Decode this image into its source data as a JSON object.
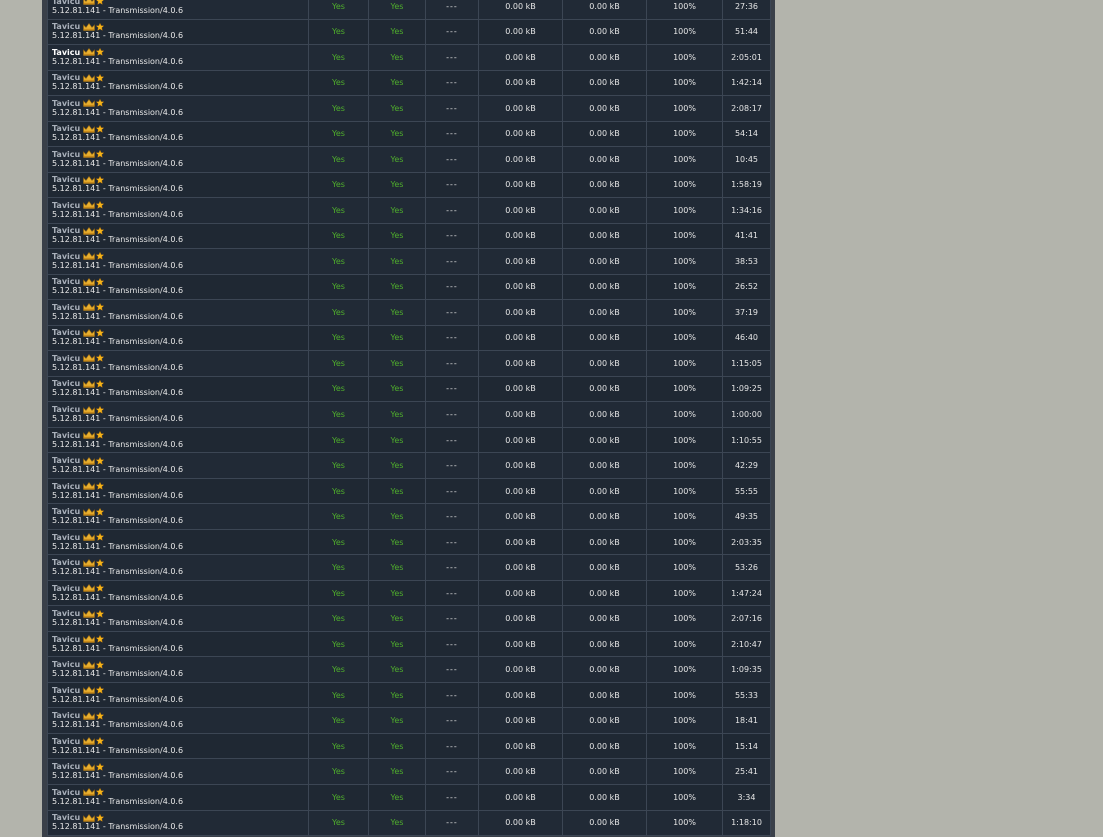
{
  "peers": {
    "rows": [
      {
        "user": "Tavicu",
        "client": "5.12.81.141 - Transmission/4.0.6",
        "connectable": "Yes",
        "seeding": "Yes",
        "speed": "---",
        "uploaded": "0.00 kB",
        "downloaded": "0.00 kB",
        "progress": "100%",
        "time": "27:36"
      },
      {
        "user": "Tavicu",
        "client": "5.12.81.141 - Transmission/4.0.6",
        "connectable": "Yes",
        "seeding": "Yes",
        "speed": "---",
        "uploaded": "0.00 kB",
        "downloaded": "0.00 kB",
        "progress": "100%",
        "time": "51:44"
      },
      {
        "user": "Tavicu",
        "client": "5.12.81.141 - Transmission/4.0.6",
        "connectable": "Yes",
        "seeding": "Yes",
        "speed": "---",
        "uploaded": "0.00 kB",
        "downloaded": "0.00 kB",
        "progress": "100%",
        "time": "2:05:01"
      },
      {
        "user": "Tavicu",
        "client": "5.12.81.141 - Transmission/4.0.6",
        "connectable": "Yes",
        "seeding": "Yes",
        "speed": "---",
        "uploaded": "0.00 kB",
        "downloaded": "0.00 kB",
        "progress": "100%",
        "time": "1:42:14"
      },
      {
        "user": "Tavicu",
        "client": "5.12.81.141 - Transmission/4.0.6",
        "connectable": "Yes",
        "seeding": "Yes",
        "speed": "---",
        "uploaded": "0.00 kB",
        "downloaded": "0.00 kB",
        "progress": "100%",
        "time": "2:08:17"
      },
      {
        "user": "Tavicu",
        "client": "5.12.81.141 - Transmission/4.0.6",
        "connectable": "Yes",
        "seeding": "Yes",
        "speed": "---",
        "uploaded": "0.00 kB",
        "downloaded": "0.00 kB",
        "progress": "100%",
        "time": "54:14"
      },
      {
        "user": "Tavicu",
        "client": "5.12.81.141 - Transmission/4.0.6",
        "connectable": "Yes",
        "seeding": "Yes",
        "speed": "---",
        "uploaded": "0.00 kB",
        "downloaded": "0.00 kB",
        "progress": "100%",
        "time": "10:45"
      },
      {
        "user": "Tavicu",
        "client": "5.12.81.141 - Transmission/4.0.6",
        "connectable": "Yes",
        "seeding": "Yes",
        "speed": "---",
        "uploaded": "0.00 kB",
        "downloaded": "0.00 kB",
        "progress": "100%",
        "time": "1:58:19"
      },
      {
        "user": "Tavicu",
        "client": "5.12.81.141 - Transmission/4.0.6",
        "connectable": "Yes",
        "seeding": "Yes",
        "speed": "---",
        "uploaded": "0.00 kB",
        "downloaded": "0.00 kB",
        "progress": "100%",
        "time": "1:34:16"
      },
      {
        "user": "Tavicu",
        "client": "5.12.81.141 - Transmission/4.0.6",
        "connectable": "Yes",
        "seeding": "Yes",
        "speed": "---",
        "uploaded": "0.00 kB",
        "downloaded": "0.00 kB",
        "progress": "100%",
        "time": "41:41"
      },
      {
        "user": "Tavicu",
        "client": "5.12.81.141 - Transmission/4.0.6",
        "connectable": "Yes",
        "seeding": "Yes",
        "speed": "---",
        "uploaded": "0.00 kB",
        "downloaded": "0.00 kB",
        "progress": "100%",
        "time": "38:53"
      },
      {
        "user": "Tavicu",
        "client": "5.12.81.141 - Transmission/4.0.6",
        "connectable": "Yes",
        "seeding": "Yes",
        "speed": "---",
        "uploaded": "0.00 kB",
        "downloaded": "0.00 kB",
        "progress": "100%",
        "time": "26:52"
      },
      {
        "user": "Tavicu",
        "client": "5.12.81.141 - Transmission/4.0.6",
        "connectable": "Yes",
        "seeding": "Yes",
        "speed": "---",
        "uploaded": "0.00 kB",
        "downloaded": "0.00 kB",
        "progress": "100%",
        "time": "37:19"
      },
      {
        "user": "Tavicu",
        "client": "5.12.81.141 - Transmission/4.0.6",
        "connectable": "Yes",
        "seeding": "Yes",
        "speed": "---",
        "uploaded": "0.00 kB",
        "downloaded": "0.00 kB",
        "progress": "100%",
        "time": "46:40"
      },
      {
        "user": "Tavicu",
        "client": "5.12.81.141 - Transmission/4.0.6",
        "connectable": "Yes",
        "seeding": "Yes",
        "speed": "---",
        "uploaded": "0.00 kB",
        "downloaded": "0.00 kB",
        "progress": "100%",
        "time": "1:15:05"
      },
      {
        "user": "Tavicu",
        "client": "5.12.81.141 - Transmission/4.0.6",
        "connectable": "Yes",
        "seeding": "Yes",
        "speed": "---",
        "uploaded": "0.00 kB",
        "downloaded": "0.00 kB",
        "progress": "100%",
        "time": "1:09:25"
      },
      {
        "user": "Tavicu",
        "client": "5.12.81.141 - Transmission/4.0.6",
        "connectable": "Yes",
        "seeding": "Yes",
        "speed": "---",
        "uploaded": "0.00 kB",
        "downloaded": "0.00 kB",
        "progress": "100%",
        "time": "1:00:00"
      },
      {
        "user": "Tavicu",
        "client": "5.12.81.141 - Transmission/4.0.6",
        "connectable": "Yes",
        "seeding": "Yes",
        "speed": "---",
        "uploaded": "0.00 kB",
        "downloaded": "0.00 kB",
        "progress": "100%",
        "time": "1:10:55"
      },
      {
        "user": "Tavicu",
        "client": "5.12.81.141 - Transmission/4.0.6",
        "connectable": "Yes",
        "seeding": "Yes",
        "speed": "---",
        "uploaded": "0.00 kB",
        "downloaded": "0.00 kB",
        "progress": "100%",
        "time": "42:29"
      },
      {
        "user": "Tavicu",
        "client": "5.12.81.141 - Transmission/4.0.6",
        "connectable": "Yes",
        "seeding": "Yes",
        "speed": "---",
        "uploaded": "0.00 kB",
        "downloaded": "0.00 kB",
        "progress": "100%",
        "time": "55:55"
      },
      {
        "user": "Tavicu",
        "client": "5.12.81.141 - Transmission/4.0.6",
        "connectable": "Yes",
        "seeding": "Yes",
        "speed": "---",
        "uploaded": "0.00 kB",
        "downloaded": "0.00 kB",
        "progress": "100%",
        "time": "49:35"
      },
      {
        "user": "Tavicu",
        "client": "5.12.81.141 - Transmission/4.0.6",
        "connectable": "Yes",
        "seeding": "Yes",
        "speed": "---",
        "uploaded": "0.00 kB",
        "downloaded": "0.00 kB",
        "progress": "100%",
        "time": "2:03:35"
      },
      {
        "user": "Tavicu",
        "client": "5.12.81.141 - Transmission/4.0.6",
        "connectable": "Yes",
        "seeding": "Yes",
        "speed": "---",
        "uploaded": "0.00 kB",
        "downloaded": "0.00 kB",
        "progress": "100%",
        "time": "53:26"
      },
      {
        "user": "Tavicu",
        "client": "5.12.81.141 - Transmission/4.0.6",
        "connectable": "Yes",
        "seeding": "Yes",
        "speed": "---",
        "uploaded": "0.00 kB",
        "downloaded": "0.00 kB",
        "progress": "100%",
        "time": "1:47:24"
      },
      {
        "user": "Tavicu",
        "client": "5.12.81.141 - Transmission/4.0.6",
        "connectable": "Yes",
        "seeding": "Yes",
        "speed": "---",
        "uploaded": "0.00 kB",
        "downloaded": "0.00 kB",
        "progress": "100%",
        "time": "2:07:16"
      },
      {
        "user": "Tavicu",
        "client": "5.12.81.141 - Transmission/4.0.6",
        "connectable": "Yes",
        "seeding": "Yes",
        "speed": "---",
        "uploaded": "0.00 kB",
        "downloaded": "0.00 kB",
        "progress": "100%",
        "time": "2:10:47"
      },
      {
        "user": "Tavicu",
        "client": "5.12.81.141 - Transmission/4.0.6",
        "connectable": "Yes",
        "seeding": "Yes",
        "speed": "---",
        "uploaded": "0.00 kB",
        "downloaded": "0.00 kB",
        "progress": "100%",
        "time": "1:09:35"
      },
      {
        "user": "Tavicu",
        "client": "5.12.81.141 - Transmission/4.0.6",
        "connectable": "Yes",
        "seeding": "Yes",
        "speed": "---",
        "uploaded": "0.00 kB",
        "downloaded": "0.00 kB",
        "progress": "100%",
        "time": "55:33"
      },
      {
        "user": "Tavicu",
        "client": "5.12.81.141 - Transmission/4.0.6",
        "connectable": "Yes",
        "seeding": "Yes",
        "speed": "---",
        "uploaded": "0.00 kB",
        "downloaded": "0.00 kB",
        "progress": "100%",
        "time": "18:41"
      },
      {
        "user": "Tavicu",
        "client": "5.12.81.141 - Transmission/4.0.6",
        "connectable": "Yes",
        "seeding": "Yes",
        "speed": "---",
        "uploaded": "0.00 kB",
        "downloaded": "0.00 kB",
        "progress": "100%",
        "time": "15:14"
      },
      {
        "user": "Tavicu",
        "client": "5.12.81.141 - Transmission/4.0.6",
        "connectable": "Yes",
        "seeding": "Yes",
        "speed": "---",
        "uploaded": "0.00 kB",
        "downloaded": "0.00 kB",
        "progress": "100%",
        "time": "25:41"
      },
      {
        "user": "Tavicu",
        "client": "5.12.81.141 - Transmission/4.0.6",
        "connectable": "Yes",
        "seeding": "Yes",
        "speed": "---",
        "uploaded": "0.00 kB",
        "downloaded": "0.00 kB",
        "progress": "100%",
        "time": "3:34"
      },
      {
        "user": "Tavicu",
        "client": "5.12.81.141 - Transmission/4.0.6",
        "connectable": "Yes",
        "seeding": "Yes",
        "speed": "---",
        "uploaded": "0.00 kB",
        "downloaded": "0.00 kB",
        "progress": "100%",
        "time": "1:18:10"
      }
    ]
  },
  "colors": {
    "page_bg": "#b3b4ac",
    "table_bg": "#212a36",
    "yes_green": "#4fae2c",
    "crown_gold": "#e8b030",
    "star_gold": "#f5b51a"
  },
  "icons": [
    "crown-icon",
    "star-icon"
  ]
}
